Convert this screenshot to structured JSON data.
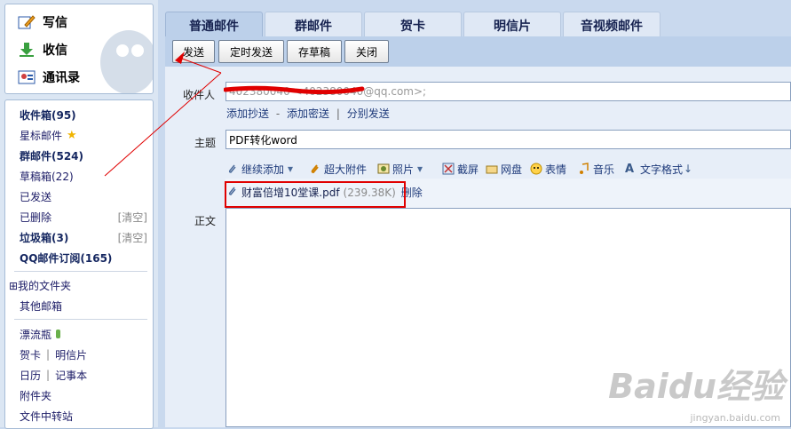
{
  "quick": {
    "write": "写信",
    "inbox": "收信",
    "contacts": "通讯录"
  },
  "folders": {
    "inbox": "收件箱(95)",
    "starred": "星标邮件",
    "group": "群邮件(524)",
    "drafts": "草稿箱(22)",
    "sent": "已发送",
    "deleted": "已删除",
    "spam": "垃圾箱(3)",
    "qq_sub": "QQ邮件订阅(165)",
    "clear": "[清空]",
    "my_folders": "⊞我的文件夹",
    "other": "其他邮箱",
    "drift": "漂流瓶",
    "card": "贺卡",
    "postcard": "明信片",
    "calendar": "日历",
    "notes": "记事本",
    "attachments": "附件夹",
    "transfer": "文件中转站",
    "divider": "|"
  },
  "tabs": [
    "普通邮件",
    "群邮件",
    "贺卡",
    "明信片",
    "音视频邮件"
  ],
  "toolbar": {
    "send": "发送",
    "timed": "定时发送",
    "save": "存草稿",
    "close": "关闭"
  },
  "compose": {
    "to_label": "收件人",
    "to_value": "402380040 <402380040@qq.com>;",
    "add_cc": "添加抄送",
    "dash": "-",
    "add_bcc": "添加密送",
    "pipe": "|",
    "separate": "分别发送",
    "subject_label": "主题",
    "subject_value": "PDF转化word",
    "body_label": "正文"
  },
  "content_tools": [
    "继续添加",
    "超大附件",
    "照片",
    "截屏",
    "网盘",
    "表情",
    "音乐",
    "文字格式"
  ],
  "attachment": {
    "name": "财富倍增10堂课.pdf",
    "size": "(239.38K)",
    "delete": "删除"
  },
  "watermark": {
    "main": "Baidu经验",
    "sub": "jingyan.baidu.com"
  },
  "colors": {
    "accent": "#e00000",
    "link": "#1e3a7a",
    "tab_bg": "#dfe8f5"
  }
}
